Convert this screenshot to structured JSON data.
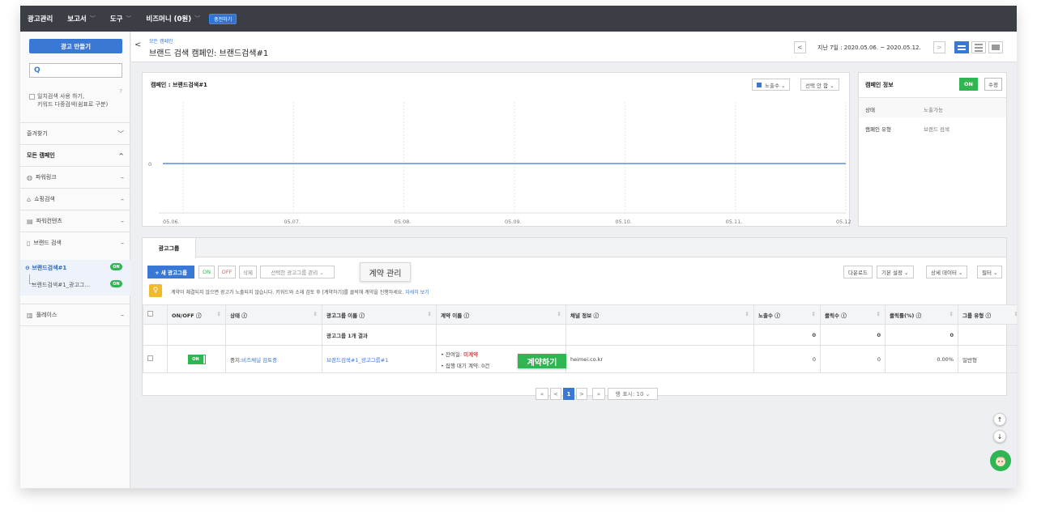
{
  "nav": {
    "items": [
      "광고관리",
      "보고서",
      "도구",
      "비즈머니 (0원)"
    ],
    "chev": "﹀",
    "charge_label": "충전하기"
  },
  "sidebar": {
    "create_label": "광고 만들기",
    "search_icon": "Q",
    "search_option_line1": "일치검색 사용 하기,",
    "search_option_line2": "키워드 다중검색(쉼표로 구분)",
    "help": "?",
    "rows": [
      {
        "label": "즐겨찾기",
        "right": "﹀"
      },
      {
        "label": "모든 캠페인",
        "right": "^"
      },
      {
        "icon": "globe-icon",
        "label": "파워링크",
        "right": "–"
      },
      {
        "icon": "shopping-icon",
        "label": "쇼핑검색",
        "right": "–"
      },
      {
        "icon": "content-icon",
        "label": "파워컨텐츠",
        "right": "–"
      },
      {
        "icon": "brand-icon",
        "label": "브랜드 검색",
        "right": "–"
      },
      {
        "icon": "place-icon",
        "label": "플레이스",
        "right": "–"
      }
    ],
    "campaign": "브랜드검색#1",
    "adgroup": "브랜드검색#1_광고그...",
    "on": "ON"
  },
  "header": {
    "back": "<",
    "breadcrumb": "모든 캠페인",
    "title": "브랜드 검색 캠페인: 브랜드검색#1",
    "prev": "<",
    "next": ">",
    "date_range": "지난 7일 : 2020.05.06. ~ 2020.05.12."
  },
  "chart_panel": {
    "title": "캠페인 : 브랜드검색#1",
    "metric_select": "노출수 ⌄",
    "compare_select": "선택 안 함 ⌄"
  },
  "chart_data": {
    "type": "line",
    "x": [
      "05.06.",
      "05.07.",
      "05.08.",
      "05.09.",
      "05.10.",
      "05.11.",
      "05.12."
    ],
    "series": [
      {
        "values": [
          0,
          0,
          0,
          0,
          0,
          0,
          0
        ]
      }
    ],
    "y_tick": "0",
    "color": "#3a78d6"
  },
  "info": {
    "title": "캠페인 정보",
    "on": "ON",
    "edit": "수정",
    "rows": [
      {
        "key": "상태",
        "value": "노출가능"
      },
      {
        "key": "캠페인 유형",
        "value": "브랜드 검색"
      }
    ]
  },
  "group": {
    "tab": "광고그룹",
    "new_group": "+ 새 광고그룹",
    "on": "ON",
    "off": "OFF",
    "delete": "삭제",
    "manage": "선택한 광고그룹 관리 ⌄",
    "tooltip": "계약 관리",
    "download": "다운로드",
    "basic_settings": "기본 설정 ⌄",
    "detail_data": "상세 데이터 ⌄",
    "filter": "필터 ⌄",
    "notice_icon": "♀",
    "notice_text": "계약이 체결되지 않으면 광고가 노출되지 않습니다. 키워드와 소재 검토 후 [계약하기]를 클릭해 계약을 진행하세요.",
    "notice_link": "자세히 보기",
    "columns": [
      "ON/OFF ⓘ",
      "상태 ⓘ",
      "광고그룹 이름 ⓘ",
      "계약 이름 ⓘ",
      "채널 정보 ⓘ",
      "노출수 ⓘ",
      "클릭수 ⓘ",
      "클릭률(%) ⓘ",
      "그룹 유형 ⓘ"
    ],
    "sort": "⇕",
    "summary": {
      "label": "광고그룹 1개 결과",
      "impressions": "0",
      "clicks": "0",
      "ctr": "0"
    },
    "row": {
      "toggle": "ON",
      "status_prefix": "중지:",
      "status_link": "비즈채널 검토중",
      "name": "브랜드검색#1_광고그룹#1",
      "contract_prefix": "• 잔여일:",
      "contract_value": "미계약",
      "contract_line2": "• 집행 대기 계약: 0건",
      "channel": "heimei.co.kr",
      "impressions": "0",
      "clicks": "0",
      "ctr": "0.00%",
      "type": "일반형"
    },
    "contract_button": "계약하기",
    "pager": {
      "first": "«",
      "prev": "<",
      "page": "1",
      "next": ">",
      "last": "»",
      "rows": "행 표시: 10 ⌄"
    }
  },
  "float": {
    "up": "↑",
    "down": "↓"
  }
}
